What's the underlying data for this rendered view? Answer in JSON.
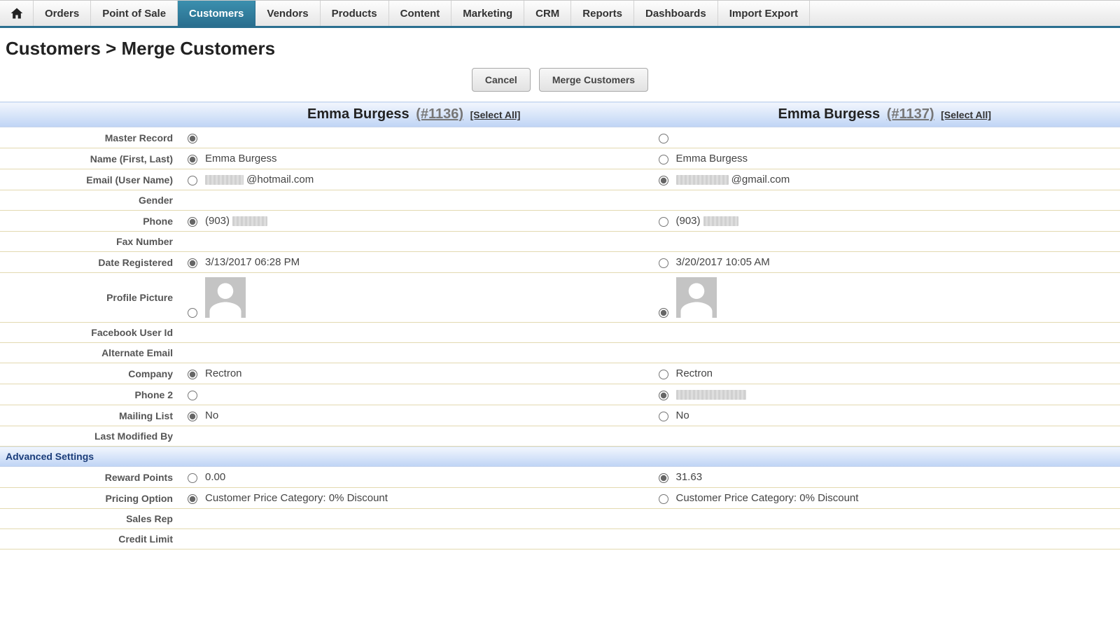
{
  "nav": {
    "items": [
      "Orders",
      "Point of Sale",
      "Customers",
      "Vendors",
      "Products",
      "Content",
      "Marketing",
      "CRM",
      "Reports",
      "Dashboards",
      "Import Export"
    ],
    "active_index": 2
  },
  "page_title": "Customers > Merge Customers",
  "buttons": {
    "cancel": "Cancel",
    "merge": "Merge Customers"
  },
  "select_all_label": "[Select All]",
  "section_advanced": "Advanced Settings",
  "row_labels": {
    "master_record": "Master Record",
    "name": "Name (First, Last)",
    "email": "Email (User Name)",
    "gender": "Gender",
    "phone": "Phone",
    "fax": "Fax Number",
    "date_registered": "Date Registered",
    "profile_picture": "Profile Picture",
    "facebook_id": "Facebook User Id",
    "alt_email": "Alternate Email",
    "company": "Company",
    "phone2": "Phone 2",
    "mailing_list": "Mailing List",
    "last_modified": "Last Modified By",
    "reward_points": "Reward Points",
    "pricing_option": "Pricing Option",
    "sales_rep": "Sales Rep",
    "credit_limit": "Credit Limit"
  },
  "customers": [
    {
      "display_name": "Emma Burgess",
      "id_label": "(#1136)",
      "name": "Emma Burgess",
      "email_suffix": "@hotmail.com",
      "phone_prefix": "(903)",
      "date_registered": "3/13/2017 06:28 PM",
      "company": "Rectron",
      "mailing_list": "No",
      "reward_points": "0.00",
      "pricing_option": "Customer Price Category: 0% Discount"
    },
    {
      "display_name": "Emma Burgess",
      "id_label": "(#1137)",
      "name": "Emma Burgess",
      "email_suffix": "@gmail.com",
      "phone_prefix": "(903)",
      "date_registered": "3/20/2017 10:05 AM",
      "company": "Rectron",
      "mailing_list": "No",
      "reward_points": "31.63",
      "pricing_option": "Customer Price Category: 0% Discount"
    }
  ],
  "selected": {
    "master_record": 0,
    "name": 0,
    "email": 1,
    "phone": 0,
    "date_registered": 0,
    "profile_picture": 1,
    "company": 0,
    "phone2": 1,
    "mailing_list": 0,
    "reward_points": 1,
    "pricing_option": 0
  }
}
